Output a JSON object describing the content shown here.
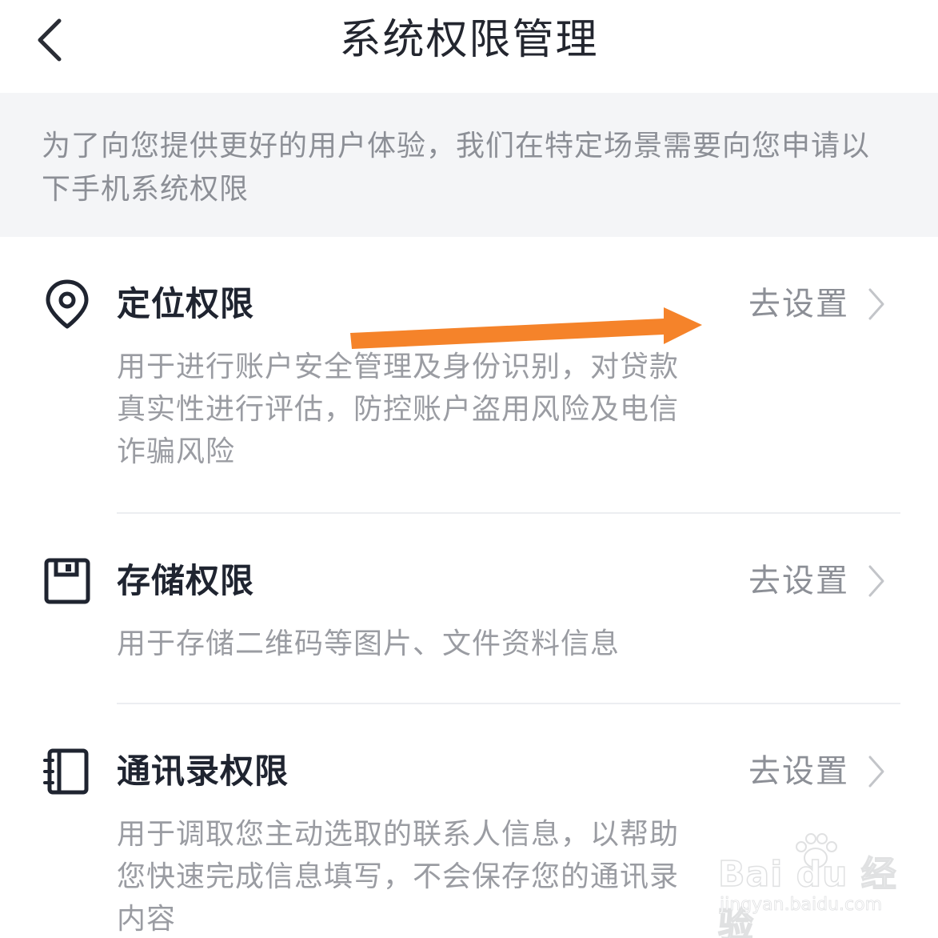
{
  "header": {
    "title": "系统权限管理"
  },
  "intro": {
    "text": "为了向您提供更好的用户体验，我们在特定场景需要向您申请以下手机系统权限"
  },
  "permissions": [
    {
      "icon": "location-pin-icon",
      "title": "定位权限",
      "description": "用于进行账户安全管理及身份识别，对贷款真实性进行评估，防控账户盗用风险及电信诈骗风险",
      "action": "去设置"
    },
    {
      "icon": "storage-icon",
      "title": "存储权限",
      "description": "用于存储二维码等图片、文件资料信息",
      "action": "去设置"
    },
    {
      "icon": "contacts-book-icon",
      "title": "通讯录权限",
      "description": "用于调取您主动选取的联系人信息，以帮助您快速完成信息填写，不会保存您的通讯录内容",
      "action": "去设置"
    }
  ],
  "annotation": {
    "arrow_color": "#f5832a"
  },
  "watermark": {
    "brand": "Bai du 经验",
    "url": "jingyan.baidu.com"
  },
  "colors": {
    "intro_bg": "#f4f5f7",
    "title": "#1f2430",
    "muted": "#9a9ca2"
  }
}
